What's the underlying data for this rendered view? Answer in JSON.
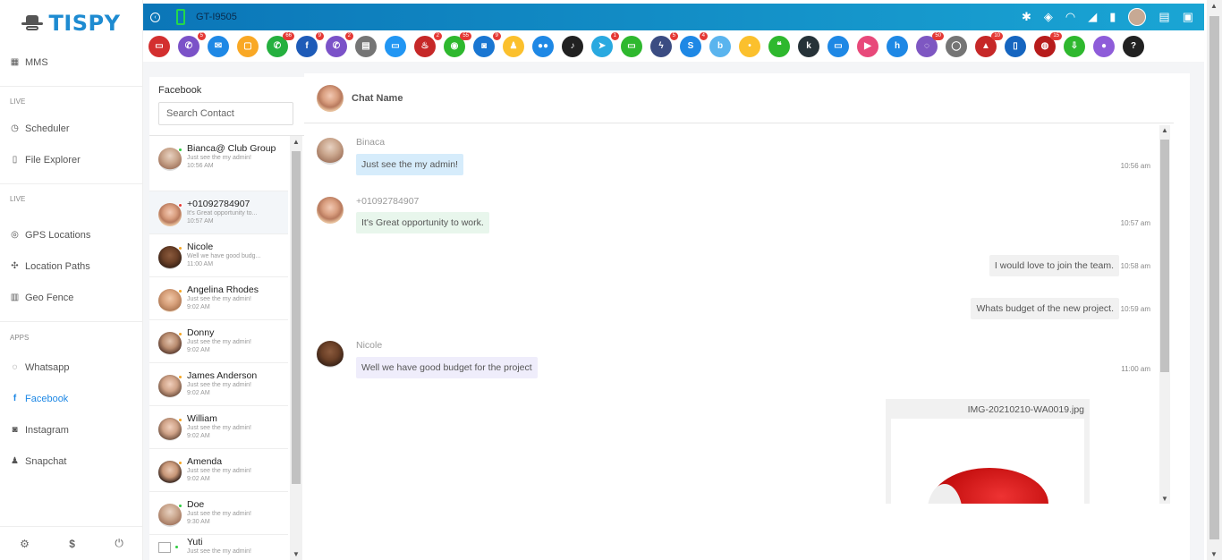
{
  "brand": {
    "name": "TISPY"
  },
  "sidebar": {
    "items": [
      {
        "label": "MMS",
        "icon": "mms-icon"
      },
      {
        "section": "LIVE"
      },
      {
        "label": "Scheduler",
        "icon": "clock-icon"
      },
      {
        "label": "File Explorer",
        "icon": "file-icon"
      },
      {
        "section": "LIVE"
      },
      {
        "label": "GPS Locations",
        "icon": "location-pin-icon"
      },
      {
        "label": "Location Paths",
        "icon": "path-icon"
      },
      {
        "label": "Geo Fence",
        "icon": "map-icon"
      },
      {
        "section": "APPS"
      },
      {
        "label": "Whatsapp",
        "icon": "whatsapp-icon"
      },
      {
        "label": "Facebook",
        "icon": "facebook-icon",
        "active": true
      },
      {
        "label": "Instagram",
        "icon": "instagram-icon"
      },
      {
        "label": "Snapchat",
        "icon": "snapchat-icon"
      }
    ],
    "footer": [
      "settings-icon",
      "dollar-icon",
      "power-icon"
    ]
  },
  "topbar": {
    "device": "GT-I9505"
  },
  "app_badges": {
    "viber": "5",
    "whatsapp": "66",
    "facebook": "9",
    "viber2": "2",
    "tinder": "2",
    "wechat": "55",
    "instagram": "9",
    "telegram": "1",
    "messenger": "5",
    "skype": "4",
    "imo": "50",
    "gallery": "10",
    "browser": "15"
  },
  "contacts": {
    "title": "Facebook",
    "search_placeholder": "Search Contact",
    "list": [
      {
        "name": "Bianca@ Club Group",
        "msg": "Just see the my admin!",
        "time": "10:56 AM",
        "status": "#2ecc40"
      },
      {
        "name": "+01092784907",
        "msg": "It's Great opportunity to...",
        "time": "10:57 AM",
        "status": "#e53935"
      },
      {
        "name": "Nicole",
        "msg": "Well we have good budg...",
        "time": "11:00 AM",
        "status": "#f5a623"
      },
      {
        "name": "Angelina Rhodes",
        "msg": "Just see the my admin!",
        "time": "9:02 AM",
        "status": "#f5a623"
      },
      {
        "name": "Donny",
        "msg": "Just see the my admin!",
        "time": "9:02 AM",
        "status": "#f5a623"
      },
      {
        "name": "James Anderson",
        "msg": "Just see the my admin!",
        "time": "9:02 AM",
        "status": "#f5a623"
      },
      {
        "name": "William",
        "msg": "Just see the my admin!",
        "time": "9:02 AM",
        "status": "#f5a623"
      },
      {
        "name": "Amenda",
        "msg": "Just see the my admin!",
        "time": "9:02 AM",
        "status": "#f5a623"
      },
      {
        "name": "Doe",
        "msg": "Just see the my admin!",
        "time": "9:30 AM",
        "status": "#2ecc40"
      },
      {
        "name": "Yuti",
        "msg": "Just see the my admin!",
        "time": "",
        "status": "#2ecc40"
      }
    ]
  },
  "chat": {
    "name": "Chat Name",
    "messages": [
      {
        "sender": "Binaca",
        "text": "Just see the my admin!",
        "time": "10:56 am"
      },
      {
        "sender": "+01092784907",
        "text": "It's Great opportunity to work.",
        "time": "10:57 am"
      },
      {
        "text": "I would love to join the team.",
        "time": "10:58 am"
      },
      {
        "text": "Whats budget of the new project.",
        "time": "10:59 am"
      },
      {
        "sender": "Nicole",
        "text": "Well we have good budget for the project",
        "time": "11:00 am"
      }
    ],
    "image_name": "IMG-20210210-WA0019.jpg"
  }
}
